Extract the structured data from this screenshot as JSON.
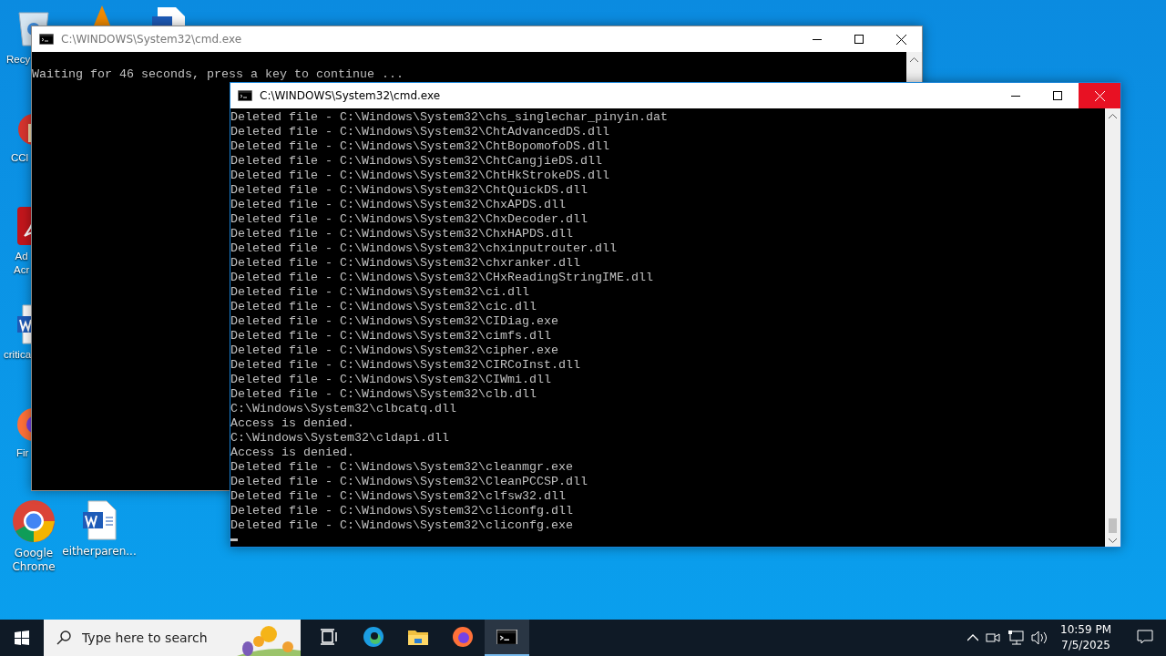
{
  "desktop_icons": [
    {
      "kind": "recycle",
      "label": "Recy"
    },
    {
      "kind": "ccleaner",
      "label": "CCl"
    },
    {
      "kind": "acrobat",
      "label": "Ad\nAcr"
    },
    {
      "kind": "word",
      "label": "critica"
    },
    {
      "kind": "firefox",
      "label": "Fir"
    },
    {
      "kind": "chrome",
      "label": "Google\nChrome"
    },
    {
      "kind": "word",
      "label": "eitherparen..."
    }
  ],
  "windows": [
    {
      "title": "C:\\WINDOWS\\System32\\cmd.exe",
      "active": false,
      "lines": [
        "Waiting for 46 seconds, press a key to continue ..."
      ]
    },
    {
      "title": "C:\\WINDOWS\\System32\\cmd.exe",
      "active": true,
      "lines": [
        "Deleted file - C:\\Windows\\System32\\chs_singlechar_pinyin.dat",
        "Deleted file - C:\\Windows\\System32\\ChtAdvancedDS.dll",
        "Deleted file - C:\\Windows\\System32\\ChtBopomofoDS.dll",
        "Deleted file - C:\\Windows\\System32\\ChtCangjieDS.dll",
        "Deleted file - C:\\Windows\\System32\\ChtHkStrokeDS.dll",
        "Deleted file - C:\\Windows\\System32\\ChtQuickDS.dll",
        "Deleted file - C:\\Windows\\System32\\ChxAPDS.dll",
        "Deleted file - C:\\Windows\\System32\\ChxDecoder.dll",
        "Deleted file - C:\\Windows\\System32\\ChxHAPDS.dll",
        "Deleted file - C:\\Windows\\System32\\chxinputrouter.dll",
        "Deleted file - C:\\Windows\\System32\\chxranker.dll",
        "Deleted file - C:\\Windows\\System32\\CHxReadingStringIME.dll",
        "Deleted file - C:\\Windows\\System32\\ci.dll",
        "Deleted file - C:\\Windows\\System32\\cic.dll",
        "Deleted file - C:\\Windows\\System32\\CIDiag.exe",
        "Deleted file - C:\\Windows\\System32\\cimfs.dll",
        "Deleted file - C:\\Windows\\System32\\cipher.exe",
        "Deleted file - C:\\Windows\\System32\\CIRCoInst.dll",
        "Deleted file - C:\\Windows\\System32\\CIWmi.dll",
        "Deleted file - C:\\Windows\\System32\\clb.dll",
        "C:\\Windows\\System32\\clbcatq.dll",
        "Access is denied.",
        "C:\\Windows\\System32\\cldapi.dll",
        "Access is denied.",
        "Deleted file - C:\\Windows\\System32\\cleanmgr.exe",
        "Deleted file - C:\\Windows\\System32\\CleanPCCSP.dll",
        "Deleted file - C:\\Windows\\System32\\clfsw32.dll",
        "Deleted file - C:\\Windows\\System32\\cliconfg.dll",
        "Deleted file - C:\\Windows\\System32\\cliconfg.exe"
      ]
    }
  ],
  "taskbar": {
    "search": {
      "placeholder": "Type here to search"
    },
    "apps": [
      {
        "kind": "taskview",
        "selected": false
      },
      {
        "kind": "edge",
        "selected": false
      },
      {
        "kind": "explorer",
        "selected": false
      },
      {
        "kind": "firefox",
        "selected": false
      },
      {
        "kind": "cmd",
        "selected": true
      }
    ],
    "time": "10:59 PM",
    "date": "7/5/2025"
  }
}
